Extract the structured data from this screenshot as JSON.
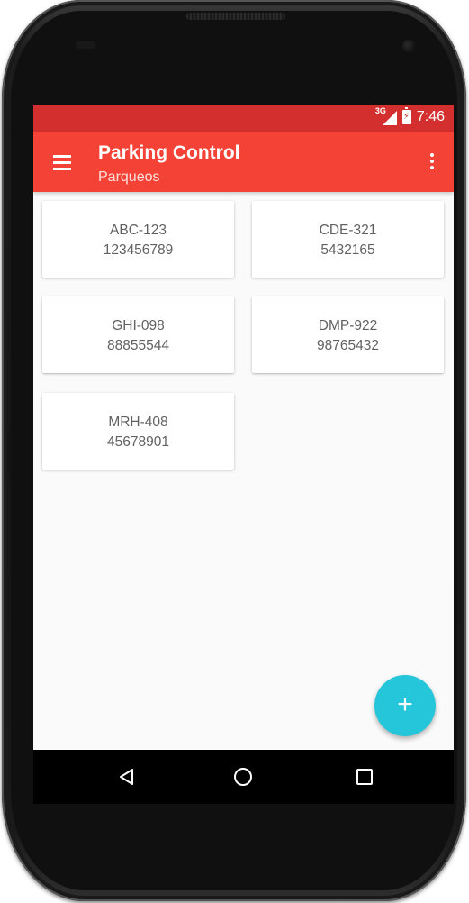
{
  "status_bar": {
    "network": "3G",
    "time": "7:46"
  },
  "toolbar": {
    "title": "Parking Control",
    "subtitle": "Parqueos",
    "menu_icon": "hamburger-menu-icon",
    "overflow_icon": "more-vert-icon"
  },
  "parkings": [
    {
      "plate": "ABC-123",
      "number": "123456789"
    },
    {
      "plate": "CDE-321",
      "number": "5432165"
    },
    {
      "plate": "GHI-098",
      "number": "88855544"
    },
    {
      "plate": "DMP-922",
      "number": "98765432"
    },
    {
      "plate": "MRH-408",
      "number": "45678901"
    }
  ],
  "fab": {
    "label": "+",
    "icon": "add-icon"
  },
  "colors": {
    "status_bar": "#d32f2f",
    "toolbar": "#f44336",
    "fab": "#26c6da",
    "background": "#fafafa",
    "card_text": "#616161"
  },
  "nav": {
    "back_icon": "back-triangle-icon",
    "home_icon": "home-circle-icon",
    "recent_icon": "recent-apps-square-icon"
  }
}
